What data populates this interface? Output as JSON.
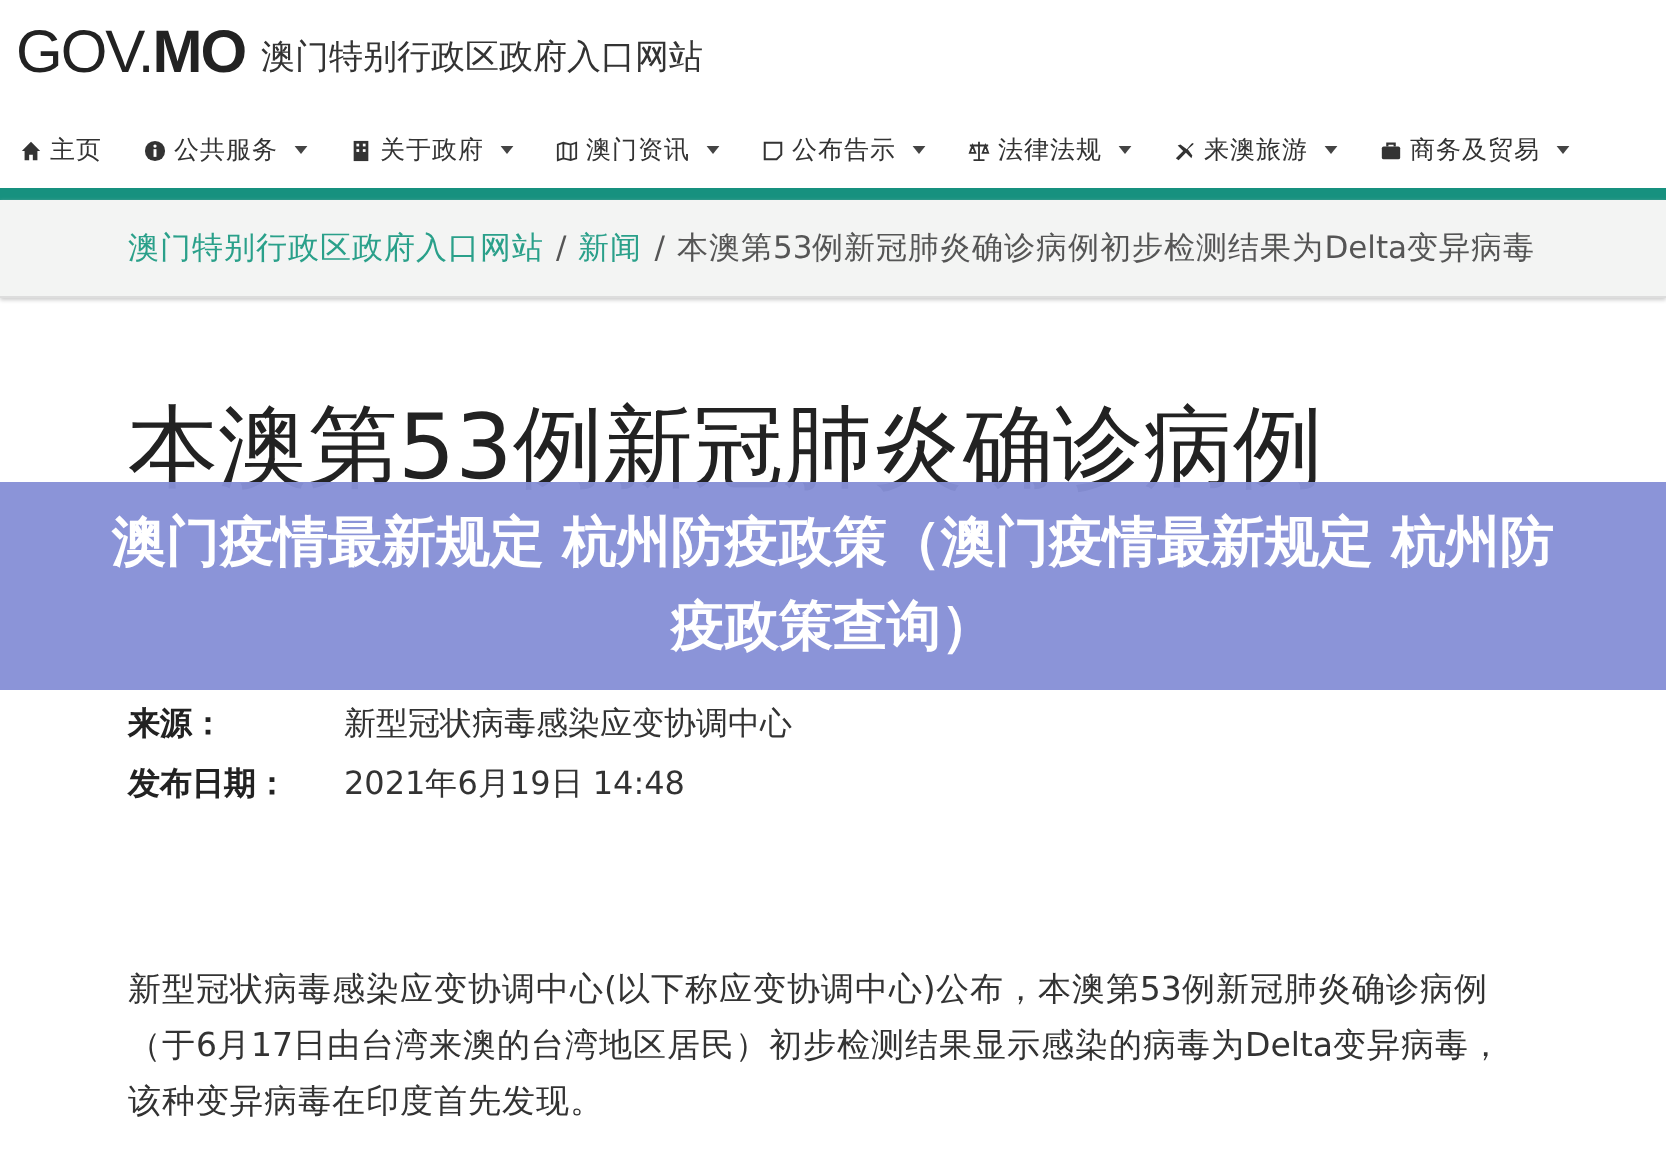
{
  "header": {
    "logo_light": "GOV.",
    "logo_bold": "MO",
    "site_name": "澳门特别行政区政府入口网站"
  },
  "nav": [
    {
      "label": "主页",
      "dropdown": false
    },
    {
      "label": "公共服务",
      "dropdown": true
    },
    {
      "label": "关于政府",
      "dropdown": true
    },
    {
      "label": "澳门资讯",
      "dropdown": true
    },
    {
      "label": "公布告示",
      "dropdown": true
    },
    {
      "label": "法律法规",
      "dropdown": true
    },
    {
      "label": "来澳旅游",
      "dropdown": true
    },
    {
      "label": "商务及贸易",
      "dropdown": true
    }
  ],
  "breadcrumb_separator": "/",
  "breadcrumb": [
    {
      "label": "澳门特别行政区政府入口网站",
      "link": true
    },
    {
      "label": "新闻",
      "link": true
    },
    {
      "label": "本澳第53例新冠肺炎确诊病例初步检测结果为Delta变异病毒",
      "link": false
    }
  ],
  "article": {
    "title": "本澳第53例新冠肺炎确诊病例",
    "meta": [
      {
        "label": "来源：",
        "value": "新型冠状病毒感染应变协调中心"
      },
      {
        "label": "发布日期：",
        "value": "2021年6月19日 14:48"
      }
    ],
    "body": "新型冠状病毒感染应变协调中心(以下称应变协调中心)公布，本澳第53例新冠肺炎确诊病例（于6月17日由台湾来澳的台湾地区居民）初步检测结果显示感染的病毒为Delta变异病毒，该种变异病毒在印度首先发现。"
  },
  "banner": {
    "text": "澳门疫情最新规定 杭州防疫政策（澳门疫情最新规定 杭州防疫政策查询）"
  }
}
